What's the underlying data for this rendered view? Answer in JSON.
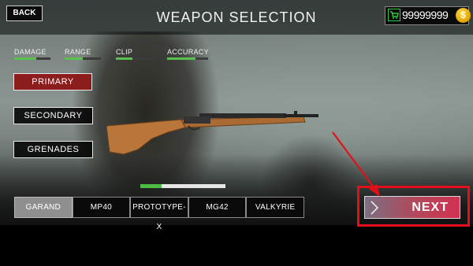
{
  "header": {
    "back_label": "BACK",
    "title": "WEAPON SELECTION",
    "currency_amount": "99999999",
    "coin_symbol": "$"
  },
  "stats": [
    {
      "label": "DAMAGE",
      "level": 0.6
    },
    {
      "label": "RANGE",
      "level": 0.5
    },
    {
      "label": "CLIP",
      "level": 0.45
    },
    {
      "label": "ACCURACY",
      "level": 0.7
    }
  ],
  "categories": {
    "primary": "PRIMARY",
    "secondary": "SECONDARY",
    "grenades": "GRENADES",
    "selected": "PRIMARY"
  },
  "selection_progress": 0.25,
  "weapons": {
    "tabs": [
      "GARAND",
      "MP40",
      "PROTOTYPE-X",
      "MG42",
      "VALKYRIE"
    ],
    "selected": "GARAND"
  },
  "next_label": "NEXT",
  "colors": {
    "accent_red": "#8c1d1d",
    "stat_green": "#58c24d",
    "annotation_red": "#e3101a"
  }
}
